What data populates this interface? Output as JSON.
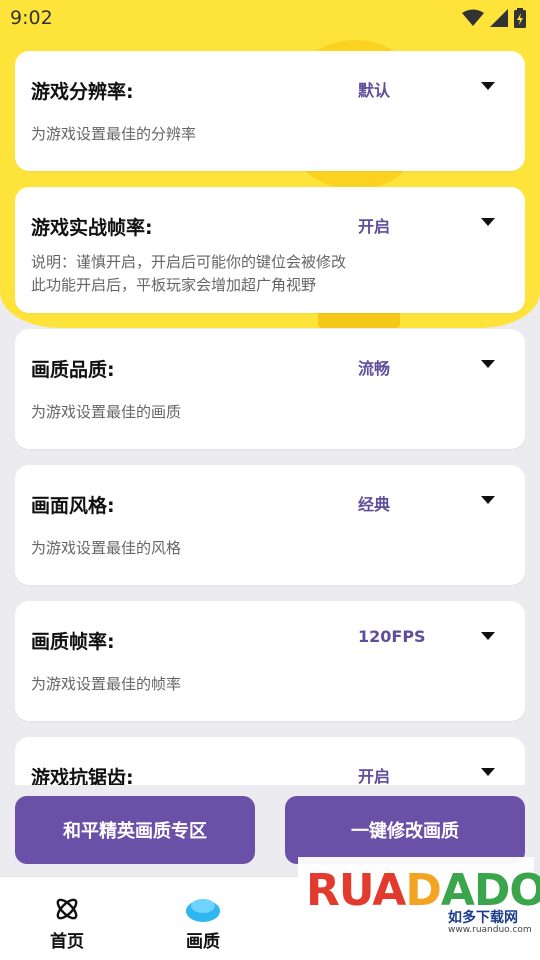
{
  "status_bar": {
    "time": "9:02"
  },
  "settings": [
    {
      "title": "游戏分辨率:",
      "value": "默认",
      "description": "为游戏设置最佳的分辨率"
    },
    {
      "title": "游戏实战帧率:",
      "value": "开启",
      "description_lines": [
        "说明：谨慎开启，开启后可能你的键位会被修改",
        "此功能开启后，平板玩家会增加超广角视野"
      ]
    },
    {
      "title": "画质品质:",
      "value": "流畅",
      "description": "为游戏设置最佳的画质"
    },
    {
      "title": "画面风格:",
      "value": "经典",
      "description": "为游戏设置最佳的风格"
    },
    {
      "title": "画质帧率:",
      "value": "120FPS",
      "description": "为游戏设置最佳的帧率"
    },
    {
      "title": "游戏抗锯齿:",
      "value": "开启"
    }
  ],
  "actions": {
    "left_button": "和平精英画质专区",
    "right_button": "一键修改画质"
  },
  "tabbar": {
    "home_label": "首页",
    "quality_label": "画质"
  },
  "watermark": {
    "logo_text": "RUANDUO",
    "subtitle": "如多下载网",
    "url": "www.ruanduo.com"
  },
  "colors": {
    "accent": "#6a50a6",
    "value_text": "#5e4e9c",
    "hero_bg": "#fde33a"
  }
}
